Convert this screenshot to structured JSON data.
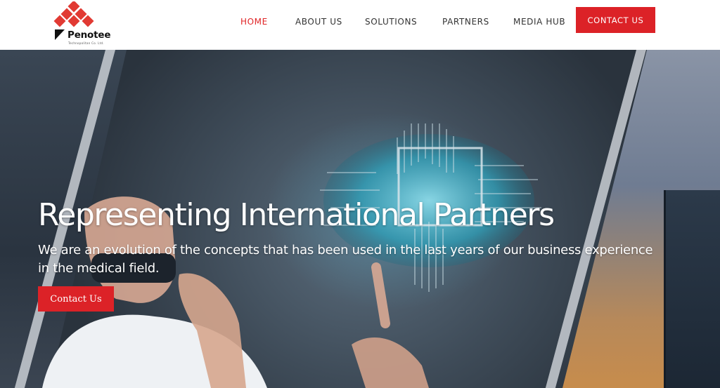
{
  "brand": {
    "name": "Penotee",
    "tagline": "Technopolitan Co. Ltd.",
    "accent": "#dc2227",
    "logo_icon": "red-diamond-grid-logo"
  },
  "nav": {
    "items": [
      {
        "label": "HOME",
        "active": true
      },
      {
        "label": "ABOUT US",
        "active": false
      },
      {
        "label": "SOLUTIONS",
        "active": false
      },
      {
        "label": "PARTNERS",
        "active": false
      },
      {
        "label": "MEDIA HUB",
        "active": false
      }
    ],
    "cta_label": "CONTACT US"
  },
  "hero": {
    "title": "Representing International Partners",
    "subtitle": "We are an evolution of the concepts that has been used in the last years of our business experience in the medical field.",
    "button_label": "Contact Us",
    "image_icon": "vr-headset-brain-circuit-illustration"
  },
  "colors": {
    "active_nav": "#e02426",
    "nav_text": "#333333",
    "button": "#dc2227"
  }
}
